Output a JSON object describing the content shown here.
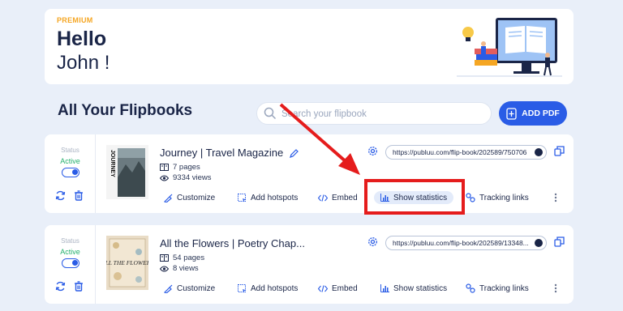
{
  "hero": {
    "badge": "PREMIUM",
    "greeting": "Hello",
    "name": "John !"
  },
  "section": {
    "title": "All Your Flipbooks"
  },
  "search": {
    "placeholder": "Search your flipbook"
  },
  "add_pdf": {
    "label": "ADD PDF"
  },
  "flipbooks": [
    {
      "status_label": "Status",
      "status_value": "Active",
      "title": "Journey | Travel Magazine",
      "pages": "7 pages",
      "views": "9334 views",
      "url": "https://publuu.com/flip-book/202589/750706",
      "cover_text": "JOURNEY",
      "actions": {
        "customize": "Customize",
        "hotspots": "Add hotspots",
        "embed": "Embed",
        "statistics": "Show statistics",
        "tracking": "Tracking links"
      }
    },
    {
      "status_label": "Status",
      "status_value": "Active",
      "title": "All the Flowers | Poetry Chap...",
      "pages": "54 pages",
      "views": "8 views",
      "url": "https://publuu.com/flip-book/202589/13348...",
      "cover_text": "ALL THE FLOWERS",
      "actions": {
        "customize": "Customize",
        "hotspots": "Add hotspots",
        "embed": "Embed",
        "statistics": "Show statistics",
        "tracking": "Tracking links"
      }
    }
  ],
  "colors": {
    "accent": "#2a5ce6",
    "active": "#25b06d",
    "premium": "#f5a623",
    "highlight": "#e51c1c"
  }
}
